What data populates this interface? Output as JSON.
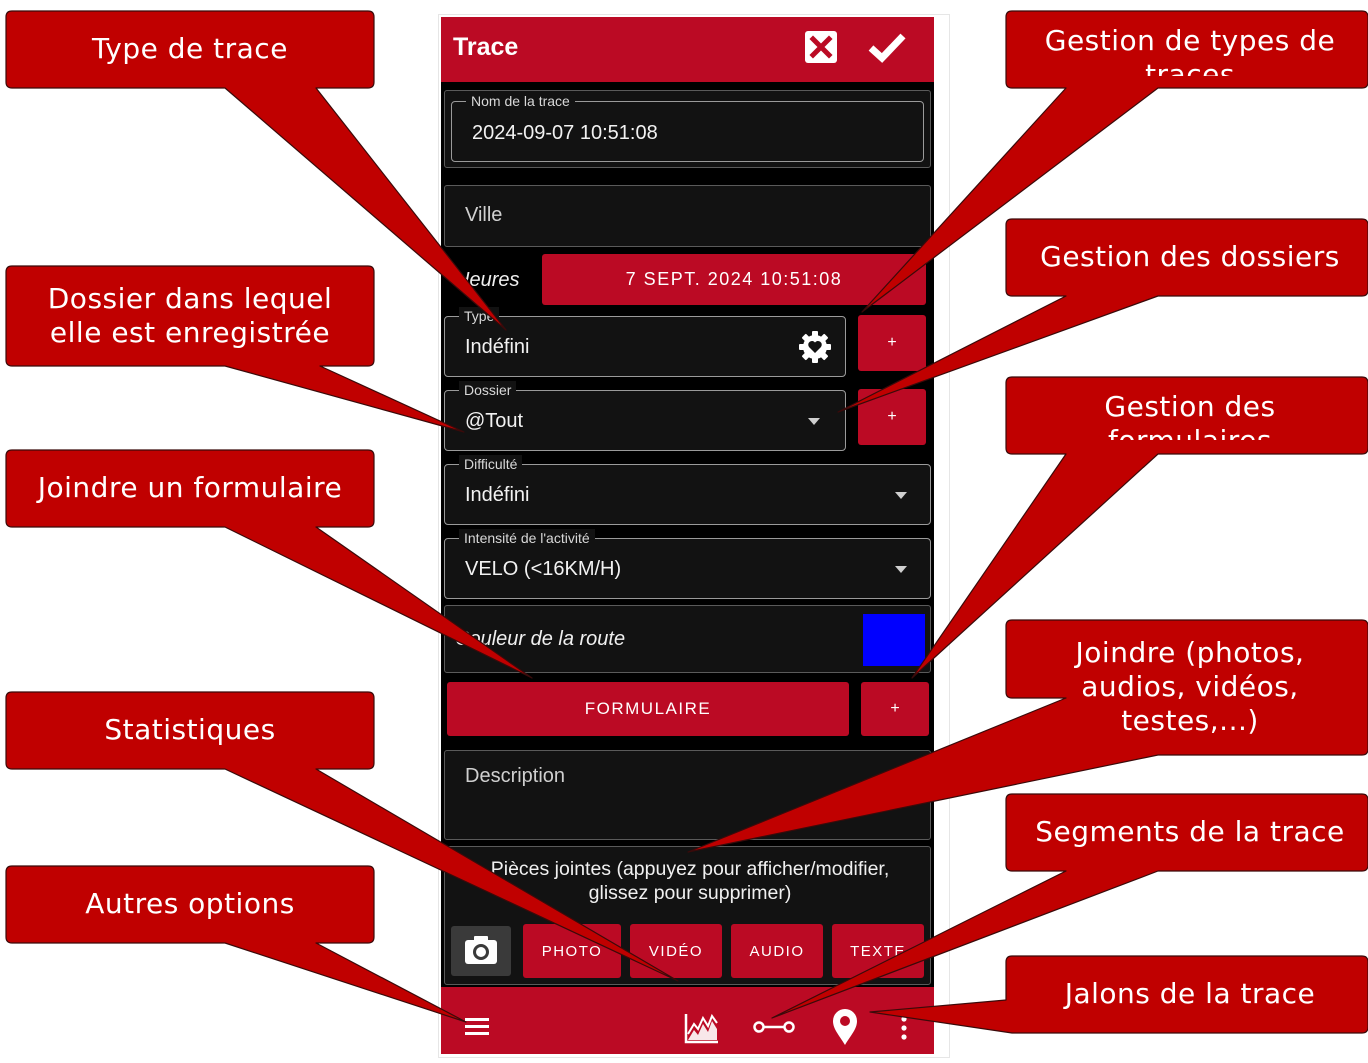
{
  "colors": {
    "accent": "#bb0a24",
    "callout_fill": "#c00000",
    "background": "#000000",
    "route_color_swatch": "#0000ff"
  },
  "app": {
    "title": "Trace",
    "cancel_icon": "close-box-icon",
    "confirm_icon": "checkmark-icon"
  },
  "form": {
    "name": {
      "label": "Nom de la trace",
      "value": "2024-09-07 10:51:08"
    },
    "city": {
      "placeholder": "Ville"
    },
    "hours": {
      "label": "Heures",
      "value": "7 SEPT. 2024 10:51:08"
    },
    "type": {
      "label": "Type",
      "value": "Indéfini",
      "icon": "gear-heart-icon",
      "add_label": "+"
    },
    "folder": {
      "label": "Dossier",
      "value": "@Tout",
      "add_label": "+"
    },
    "difficulty": {
      "label": "Difficulté",
      "value": "Indéfini"
    },
    "intensity": {
      "label": "Intensité de l'activité",
      "value": "VELO (<16KM/H)"
    },
    "route_color": {
      "label": "Couleur de la route"
    },
    "form_button": {
      "label": "FORMULAIRE",
      "add_label": "+"
    },
    "description": {
      "placeholder": "Description"
    },
    "attachments": {
      "text": "Pièces jointes (appuyez pour afficher/modifier, glissez pour supprimer)",
      "camera_icon": "camera-icon",
      "buttons": [
        "PHOTO",
        "VIDÉO",
        "AUDIO",
        "TEXTE"
      ]
    }
  },
  "bottom_bar": {
    "icons": [
      "menu-icon",
      "statistics-chart-icon",
      "segments-icon",
      "waypoint-pin-icon",
      "more-vert-icon"
    ]
  },
  "callouts": [
    {
      "id": "type",
      "text": "Type de trace"
    },
    {
      "id": "folder",
      "text": "Dossier dans lequel elle est enregistrée"
    },
    {
      "id": "form",
      "text": "Joindre un formulaire"
    },
    {
      "id": "stats",
      "text": "Statistiques"
    },
    {
      "id": "options",
      "text": "Autres options"
    },
    {
      "id": "type-mgmt",
      "text": "Gestion de types de traces"
    },
    {
      "id": "folder-mgmt",
      "text": "Gestion des dossiers"
    },
    {
      "id": "form-mgmt",
      "text": "Gestion des formulaires"
    },
    {
      "id": "attach",
      "text": "Joindre (photos, audios, vidéos, testes,...)"
    },
    {
      "id": "segments",
      "text": "Segments de la trace"
    },
    {
      "id": "waypoints",
      "text": "Jalons de la trace"
    }
  ]
}
